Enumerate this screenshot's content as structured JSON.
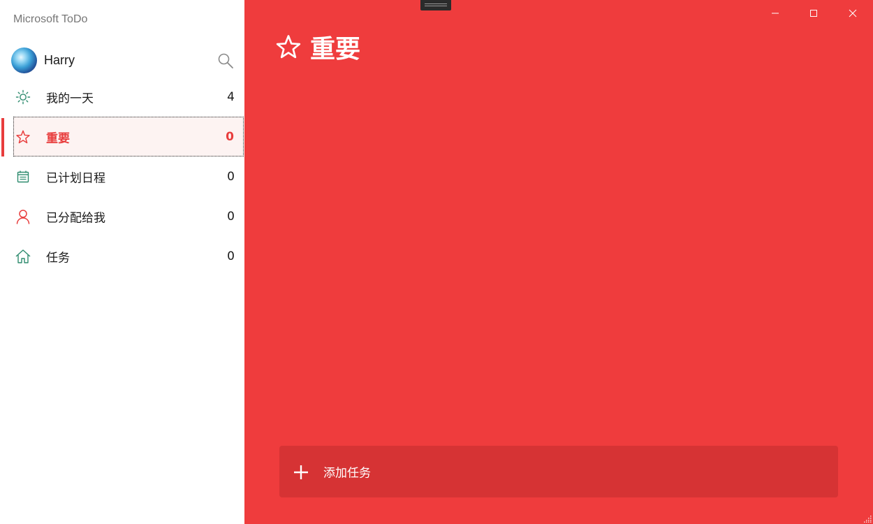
{
  "app": {
    "title": "Microsoft ToDo"
  },
  "user": {
    "name": "Harry"
  },
  "nav": {
    "items": [
      {
        "label": "我的一天",
        "count": "4",
        "icon": "sun-icon"
      },
      {
        "label": "重要",
        "count": "0",
        "icon": "star-icon",
        "active": true
      },
      {
        "label": "已计划日程",
        "count": "0",
        "icon": "calendar-icon"
      },
      {
        "label": "已分配给我",
        "count": "0",
        "icon": "person-icon"
      },
      {
        "label": "任务",
        "count": "0",
        "icon": "home-icon"
      }
    ]
  },
  "main": {
    "title": "重要",
    "add_task_label": "添加任务"
  },
  "colors": {
    "accent": "#ef3c3d",
    "add_bar": "#d63334",
    "active_bg": "#fdf3f2",
    "green_icon": "#2e8b6e"
  }
}
